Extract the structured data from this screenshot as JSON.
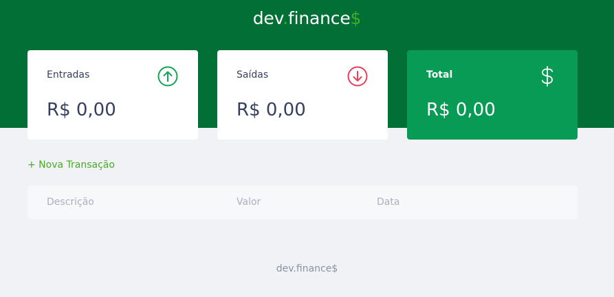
{
  "header": {
    "logo_main": "dev",
    "logo_dot": ".",
    "logo_name": "finance",
    "logo_dollar": "$"
  },
  "cards": {
    "income": {
      "label": "Entradas",
      "amount": "R$ 0,00",
      "icon": "arrow-up-circle-icon"
    },
    "expense": {
      "label": "Saídas",
      "amount": "R$ 0,00",
      "icon": "arrow-down-circle-icon"
    },
    "total": {
      "label": "Total",
      "amount": "R$ 0,00",
      "icon": "dollar-sign-icon"
    }
  },
  "actions": {
    "new_transaction": "+ Nova Transação"
  },
  "table": {
    "headers": [
      "Descrição",
      "Valor",
      "Data"
    ]
  },
  "footer": {
    "text": "dev.finance$"
  },
  "colors": {
    "header_bg": "#016f36",
    "total_bg": "#079b55",
    "accent_green": "#49aa26",
    "expense_red": "#e92929",
    "page_bg": "#f0f2f5"
  }
}
